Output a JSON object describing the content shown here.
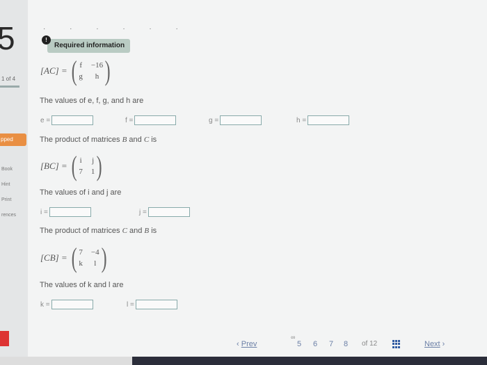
{
  "sidebar": {
    "question_number": "5",
    "position": "1 of 4",
    "skipped_label": "pped",
    "links": [
      "Book",
      "Hint",
      "Print",
      "rences"
    ]
  },
  "badge": {
    "label": "Required information"
  },
  "equations": {
    "ac": {
      "lhs": "[AC]",
      "eq": "=",
      "m11": "f",
      "m12": "−16",
      "m21": "g",
      "m22": "h"
    },
    "bc": {
      "lhs": "[BC]",
      "eq": "=",
      "m11": "i",
      "m12": "j",
      "m21": "7",
      "m22": "1"
    },
    "cb": {
      "lhs": "[CB]",
      "eq": "=",
      "m11": "7",
      "m12": "−4",
      "m21": "k",
      "m22": "l"
    }
  },
  "text": {
    "q1": "The values of e, f, g, and h are",
    "q2_prefix": "The product of matrices ",
    "q2_b": "B",
    "q2_and": " and ",
    "q2_c": "C",
    "q2_suffix": " is",
    "q3": "The values of i and j are",
    "q4_prefix": "The product of matrices ",
    "q4_c": "C",
    "q4_and": " and ",
    "q4_b": "B",
    "q4_suffix": " is",
    "q5": "The values of k and l are"
  },
  "fields": {
    "e": "e =",
    "f": "f =",
    "g": "g =",
    "h": "h =",
    "i": "i =",
    "j": "j =",
    "k": "k =",
    "l": "l ="
  },
  "pager": {
    "prev": "Prev",
    "pages": [
      "5",
      "6",
      "7",
      "8"
    ],
    "of": "of 12",
    "next": "Next"
  }
}
